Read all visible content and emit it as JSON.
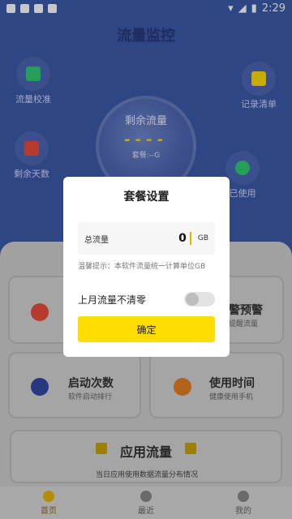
{
  "status": {
    "time": "2:29"
  },
  "header": {
    "title": "流量监控"
  },
  "side": {
    "calibrate": "流量校准",
    "remaining_days": "剩余天数",
    "records": "记录清单",
    "used": "已使用"
  },
  "dial": {
    "label": "剩余流量",
    "value": "----",
    "package": "套餐:--G"
  },
  "cards": {
    "alert": {
      "title": "警预警",
      "subtitle": "提醒流量"
    },
    "startup": {
      "title": "启动次数",
      "subtitle": "软件启动排行"
    },
    "usage_time": {
      "title": "使用时间",
      "subtitle": "健康使用手机"
    },
    "app_traffic": {
      "title": "应用流量",
      "subtitle": "当日应用使用数据流量分布情况"
    }
  },
  "nav": {
    "home": "首页",
    "recent": "最近",
    "mine": "我的"
  },
  "modal": {
    "title": "套餐设置",
    "field_label": "总流量",
    "field_value": "0",
    "unit": "GB",
    "tip": "温馨提示：本软件流量统一计算单位GB",
    "toggle_label": "上月流量不清零",
    "confirm": "确定"
  },
  "colors": {
    "accent": "#ffdc00",
    "primary": "#3d5aa9"
  }
}
